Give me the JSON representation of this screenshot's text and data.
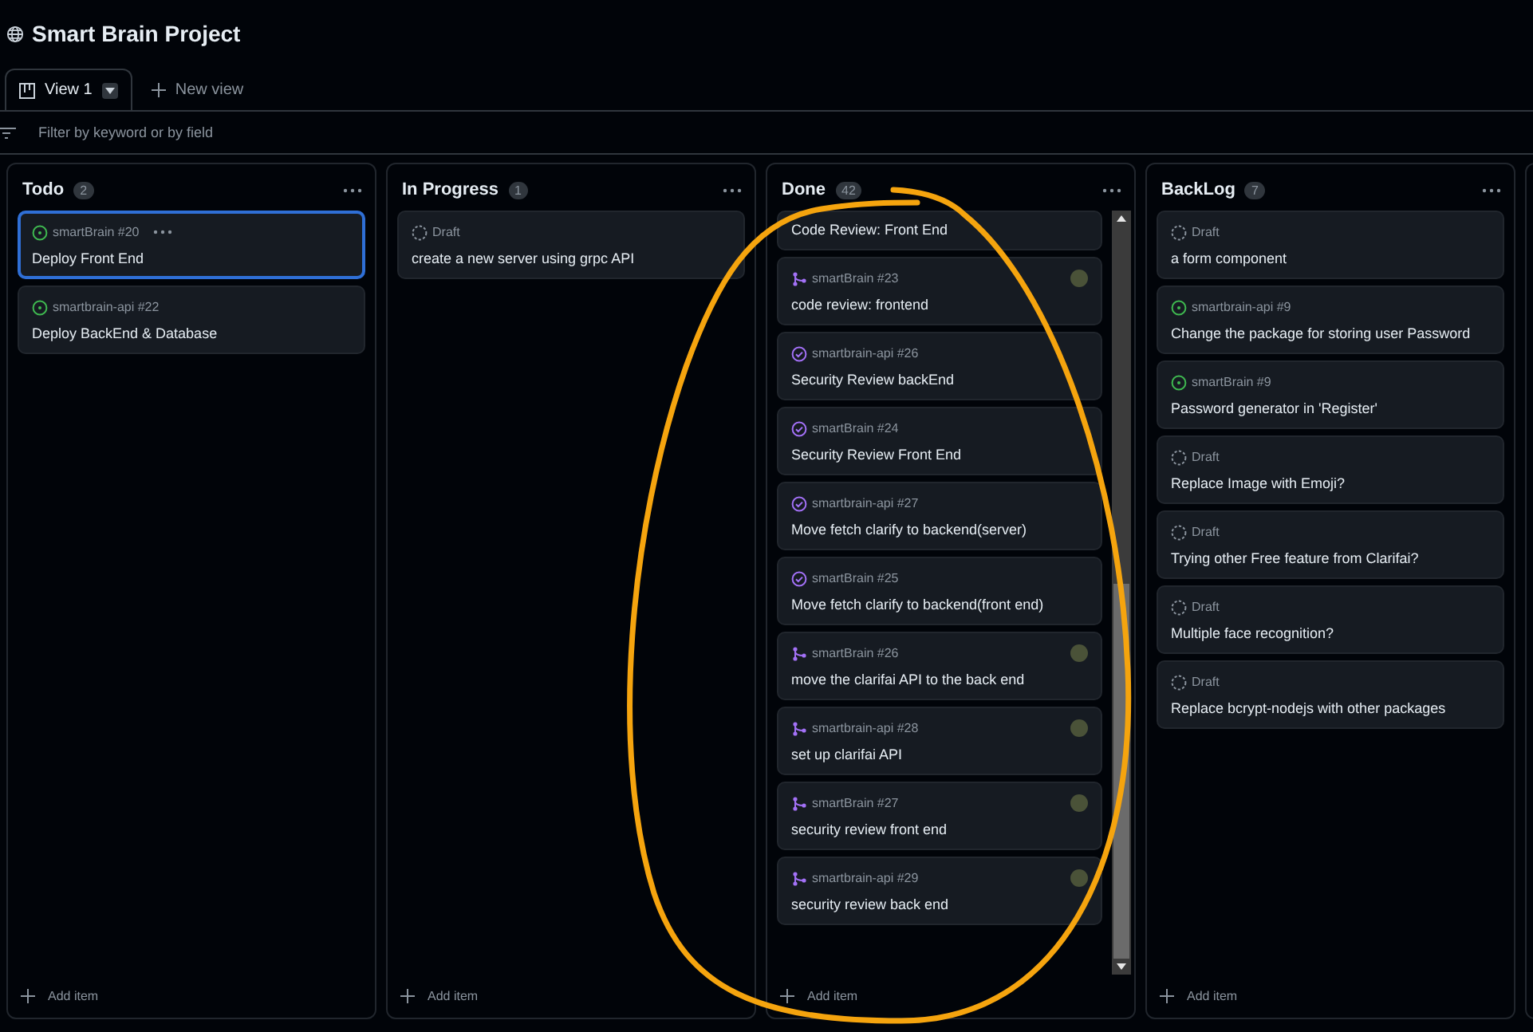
{
  "project": {
    "title": "Smart Brain Project"
  },
  "tabs": [
    {
      "label": "View 1",
      "selected": true
    }
  ],
  "new_view": "New view",
  "filter": {
    "placeholder": "Filter by keyword or by field"
  },
  "columns": [
    {
      "name": "Todo",
      "count": "2",
      "scrollbar": false,
      "add_item": "Add item",
      "cards": [
        {
          "kind": "open",
          "meta": "smartBrain #20",
          "title": "Deploy Front End",
          "selected": true,
          "assignee": false
        },
        {
          "kind": "open",
          "meta": "smartbrain-api #22",
          "title": "Deploy BackEnd & Database",
          "selected": false,
          "assignee": false
        }
      ]
    },
    {
      "name": "In Progress",
      "count": "1",
      "scrollbar": false,
      "add_item": "Add item",
      "cards": [
        {
          "kind": "draft",
          "meta": "Draft",
          "title": "create a new server using grpc API",
          "selected": false,
          "assignee": false
        }
      ]
    },
    {
      "name": "Done",
      "count": "42",
      "scrollbar": true,
      "add_item": "Add item",
      "cards": [
        {
          "kind": "cut",
          "title": "Code Review: Front End",
          "selected": false,
          "assignee": false
        },
        {
          "kind": "merged",
          "meta": "smartBrain #23",
          "title": "code review: frontend",
          "selected": false,
          "assignee": true
        },
        {
          "kind": "closed",
          "meta": "smartbrain-api #26",
          "title": "Security Review backEnd",
          "selected": false,
          "assignee": false
        },
        {
          "kind": "closed",
          "meta": "smartBrain #24",
          "title": "Security Review Front End",
          "selected": false,
          "assignee": false
        },
        {
          "kind": "closed",
          "meta": "smartbrain-api #27",
          "title": "Move fetch clarify to backend(server)",
          "selected": false,
          "assignee": false
        },
        {
          "kind": "closed",
          "meta": "smartBrain #25",
          "title": "Move fetch clarify to backend(front end)",
          "selected": false,
          "assignee": false
        },
        {
          "kind": "merged",
          "meta": "smartBrain #26",
          "title": "move the clarifai API to the back end",
          "selected": false,
          "assignee": true
        },
        {
          "kind": "merged",
          "meta": "smartbrain-api #28",
          "title": "set up clarifai API",
          "selected": false,
          "assignee": true
        },
        {
          "kind": "merged",
          "meta": "smartBrain #27",
          "title": "security review front end",
          "selected": false,
          "assignee": true
        },
        {
          "kind": "merged",
          "meta": "smartbrain-api #29",
          "title": "security review back end",
          "selected": false,
          "assignee": true
        }
      ]
    },
    {
      "name": "BackLog",
      "count": "7",
      "scrollbar": false,
      "add_item": "Add item",
      "cards": [
        {
          "kind": "draft",
          "meta": "Draft",
          "title": "a form component",
          "selected": false,
          "assignee": false
        },
        {
          "kind": "open",
          "meta": "smartbrain-api #9",
          "title": "Change the package for storing user Password",
          "selected": false,
          "assignee": false
        },
        {
          "kind": "open",
          "meta": "smartBrain #9",
          "title": "Password generator in 'Register'",
          "selected": false,
          "assignee": false
        },
        {
          "kind": "draft",
          "meta": "Draft",
          "title": "Replace Image with Emoji?",
          "selected": false,
          "assignee": false
        },
        {
          "kind": "draft",
          "meta": "Draft",
          "title": "Trying other Free feature from Clarifai?",
          "selected": false,
          "assignee": false
        },
        {
          "kind": "draft",
          "meta": "Draft",
          "title": "Multiple face recognition?",
          "selected": false,
          "assignee": false
        },
        {
          "kind": "draft",
          "meta": "Draft",
          "title": "Replace bcrypt-nodejs with other packages",
          "selected": false,
          "assignee": false
        }
      ]
    }
  ]
}
